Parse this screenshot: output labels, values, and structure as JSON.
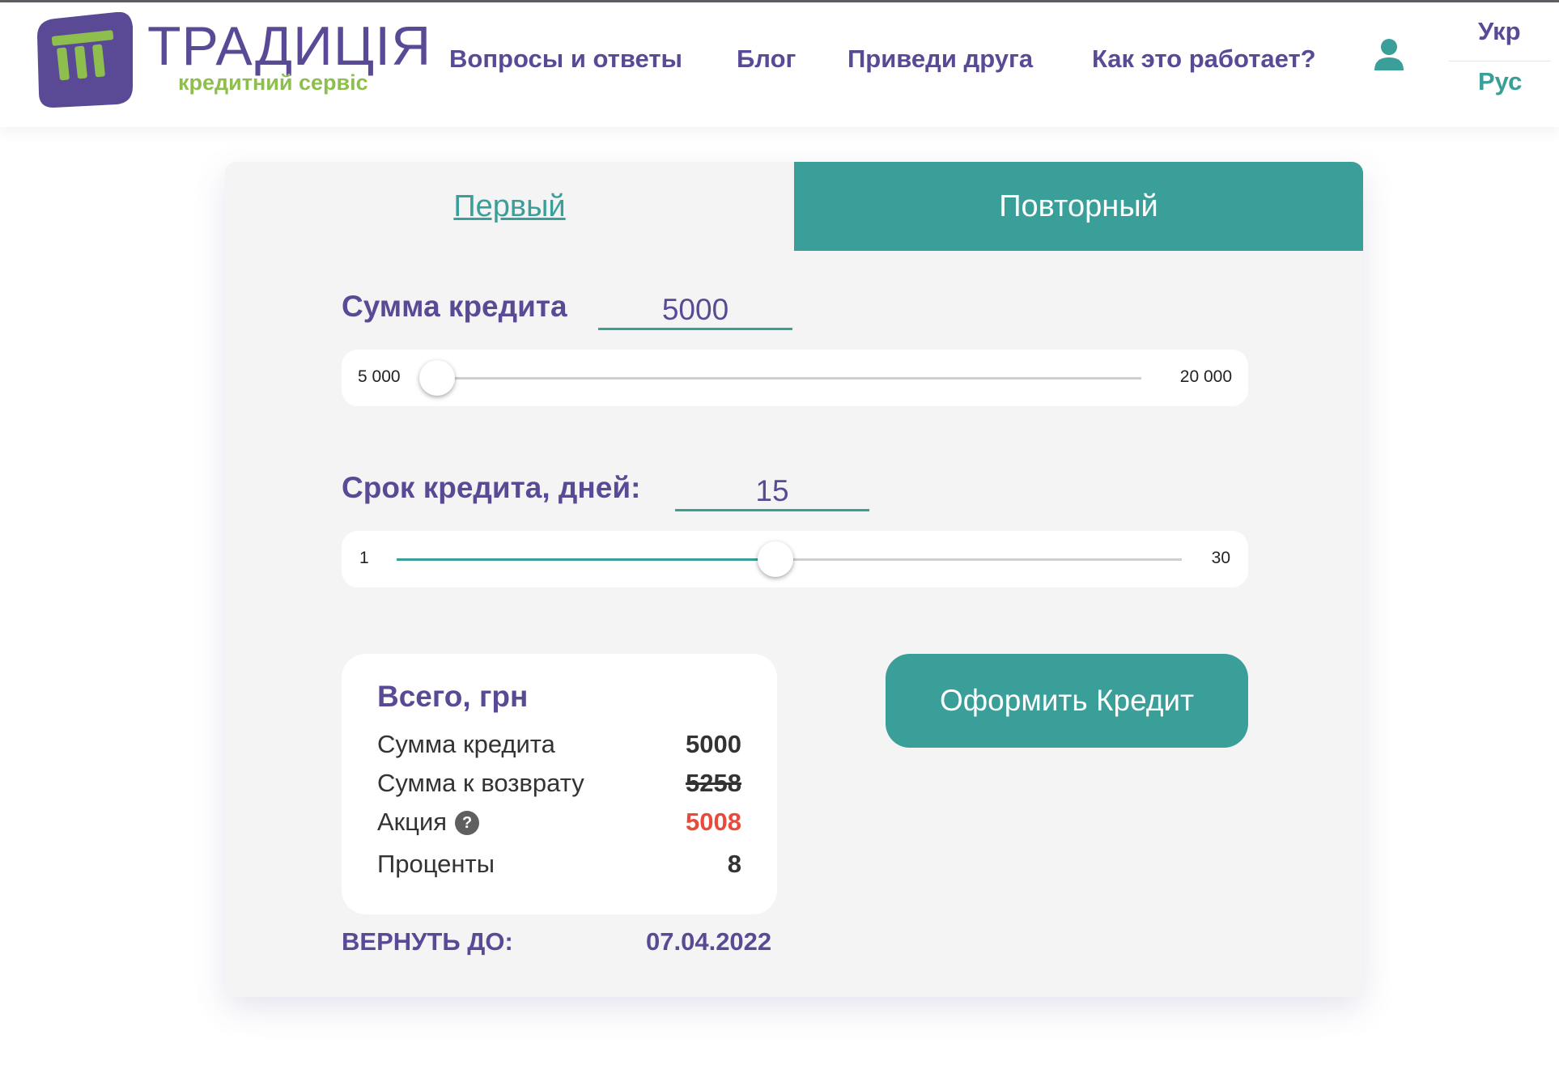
{
  "header": {
    "logo_title": "ТРАДИЦІЯ",
    "logo_subtitle": "кредитний сервіс",
    "nav": [
      "Вопросы и ответы",
      "Блог",
      "Приведи друга",
      "Как это работает?"
    ],
    "lang_ukr": "Укр",
    "lang_rus": "Рус"
  },
  "colors": {
    "brand_purple": "#5a4a96",
    "brand_teal": "#3a9e99",
    "brand_green": "#8ebf4e",
    "promo_red": "#e84a3c"
  },
  "tabs": {
    "first": "Первый",
    "repeat": "Повторный"
  },
  "amount": {
    "label": "Сумма кредита",
    "value": "5000",
    "slider_min": "5 000",
    "slider_max": "20 000",
    "slider_fraction": 0.0
  },
  "term": {
    "label": "Срок кредита, дней:",
    "value": "15",
    "slider_min": "1",
    "slider_max": "30",
    "slider_fraction": 0.4828
  },
  "summary": {
    "title": "Всего, грн",
    "rows": [
      {
        "label": "Сумма кредита",
        "value": "5000"
      },
      {
        "label": "Сумма к возврату",
        "value": "5258"
      },
      {
        "label": "Акция",
        "value": "5008"
      },
      {
        "label": "Проценты",
        "value": "8"
      }
    ],
    "help_icon": "?"
  },
  "return": {
    "label": "ВЕРНУТЬ ДО:",
    "date": "07.04.2022"
  },
  "cta_label": "Оформить Кредит"
}
